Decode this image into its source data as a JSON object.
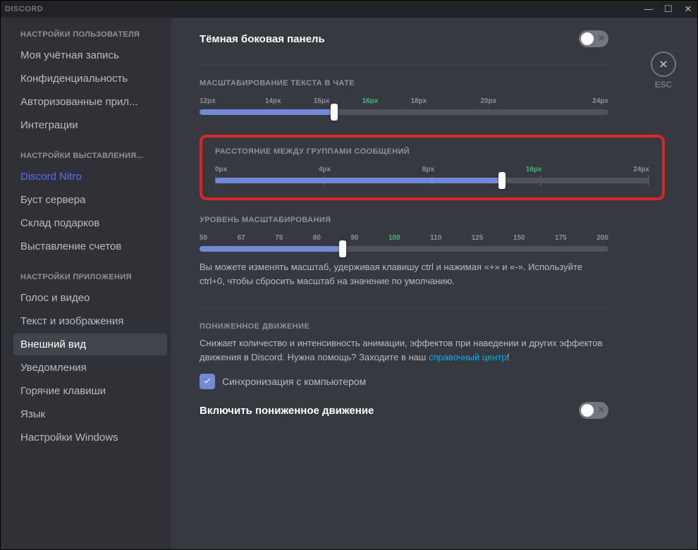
{
  "app": {
    "name": "DISCORD",
    "esc_label": "ESC"
  },
  "sidebar": {
    "header_user": "НАСТРОЙКИ ПОЛЬЗОВАТЕЛЯ",
    "user_items": [
      "Моя учётная запись",
      "Конфиденциальность",
      "Авторизованные прил...",
      "Интеграции"
    ],
    "header_billing": "НАСТРОЙКИ ВЫСТАВЛЕНИЯ...",
    "billing_items": [
      "Discord Nitro",
      "Буст сервера",
      "Склад подарков",
      "Выставление счетов"
    ],
    "header_app": "НАСТРОЙКИ ПРИЛОЖЕНИЯ",
    "app_items": [
      "Голос и видео",
      "Текст и изображения",
      "Внешний вид",
      "Уведомления",
      "Горячие клавиши",
      "Язык",
      "Настройки Windows"
    ]
  },
  "settings": {
    "dark_sidebar": "Тёмная боковая панель",
    "font_scaling": {
      "label": "МАСШТАБИРОВАНИЕ ТЕКСТА В ЧАТЕ",
      "ticks": [
        "12px",
        "14px",
        "15px",
        "16px",
        "18px",
        "20px",
        "24px"
      ],
      "active_index": 3,
      "fill_percent": 33
    },
    "message_spacing": {
      "label": "РАССТОЯНИЕ МЕЖДУ ГРУППАМИ СООБЩЕНИЙ",
      "ticks": [
        "0px",
        "4px",
        "8px",
        "16px",
        "24px"
      ],
      "active_index": 3,
      "fill_percent": 66
    },
    "zoom": {
      "label": "УРОВЕНЬ МАСШТАБИРОВАНИЯ",
      "ticks": [
        "50",
        "67",
        "75",
        "80",
        "90",
        "100",
        "110",
        "125",
        "150",
        "175",
        "200"
      ],
      "active_index": 5,
      "fill_percent": 35,
      "help": "Вы можете изменять масштаб, удерживая клавишу ctrl и нажимая «+» и «-». Используйте ctrl+0, чтобы сбросить масштаб на значение по умолчанию."
    },
    "reduced_motion": {
      "label": "ПОНИЖЕННОЕ ДВИЖЕНИЕ",
      "desc_pre": "Снижает количество и интенсивность анимации, эффектов при наведении и других эффектов движения в Discord. Нужна помощь? Заходите в наш ",
      "link": "справочный центр",
      "desc_post": "!",
      "sync_label": "Синхронизация с компьютером",
      "enable_label": "Включить пониженное движение"
    }
  }
}
